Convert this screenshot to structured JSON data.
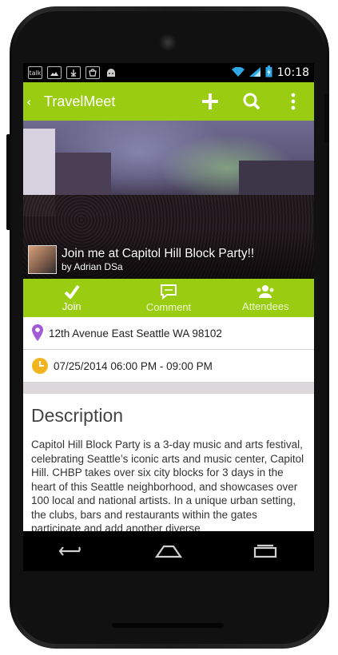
{
  "status_bar": {
    "left_icons": [
      "talk-icon",
      "image-icon",
      "download-icon",
      "store-icon",
      "android-icon"
    ],
    "left_icon_text": "talk",
    "time": "10:18"
  },
  "action_bar": {
    "title": "TravelMeet",
    "actions": [
      "add-icon",
      "search-icon",
      "overflow-icon"
    ],
    "accent": "#9acd12"
  },
  "event": {
    "title": "Join me at Capitol Hill Block Party!!",
    "by": "by Adrian DSa"
  },
  "tabs": [
    {
      "label": "Join",
      "icon": "checkmark-icon"
    },
    {
      "label": "Comment",
      "icon": "comment-icon"
    },
    {
      "label": "Attendees",
      "icon": "attendees-icon"
    }
  ],
  "location": {
    "text": "12th Avenue East Seattle WA 98102",
    "icon": "location-pin-icon",
    "color": "#a25ad6"
  },
  "time_range": {
    "text": "07/25/2014 06:00 PM - 09:00 PM",
    "icon": "clock-icon",
    "color": "#f2b51f"
  },
  "description": {
    "heading": "Description",
    "body": "Capitol Hill Block Party is a 3-day music and arts festival, celebrating Seattle’s iconic arts and music center, Capitol Hill. CHBP takes over six city blocks for 3 days in the heart of this Seattle neighborhood, and showcases over 100 local and national artists. In a unique urban setting, the clubs, bars and restaurants within the gates participate and add another diverse"
  },
  "nav_bar": [
    "back-icon",
    "home-icon",
    "recents-icon"
  ]
}
